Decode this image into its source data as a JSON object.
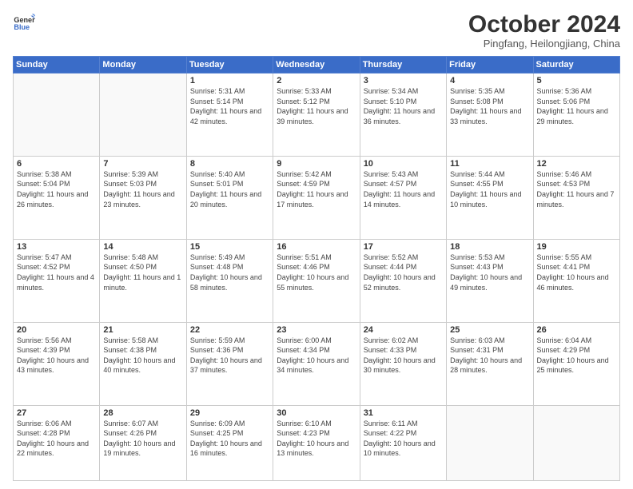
{
  "header": {
    "logo_line1": "General",
    "logo_line2": "Blue",
    "title": "October 2024",
    "subtitle": "Pingfang, Heilongjiang, China"
  },
  "weekdays": [
    "Sunday",
    "Monday",
    "Tuesday",
    "Wednesday",
    "Thursday",
    "Friday",
    "Saturday"
  ],
  "weeks": [
    [
      {
        "day": "",
        "info": ""
      },
      {
        "day": "",
        "info": ""
      },
      {
        "day": "1",
        "info": "Sunrise: 5:31 AM\nSunset: 5:14 PM\nDaylight: 11 hours and 42 minutes."
      },
      {
        "day": "2",
        "info": "Sunrise: 5:33 AM\nSunset: 5:12 PM\nDaylight: 11 hours and 39 minutes."
      },
      {
        "day": "3",
        "info": "Sunrise: 5:34 AM\nSunset: 5:10 PM\nDaylight: 11 hours and 36 minutes."
      },
      {
        "day": "4",
        "info": "Sunrise: 5:35 AM\nSunset: 5:08 PM\nDaylight: 11 hours and 33 minutes."
      },
      {
        "day": "5",
        "info": "Sunrise: 5:36 AM\nSunset: 5:06 PM\nDaylight: 11 hours and 29 minutes."
      }
    ],
    [
      {
        "day": "6",
        "info": "Sunrise: 5:38 AM\nSunset: 5:04 PM\nDaylight: 11 hours and 26 minutes."
      },
      {
        "day": "7",
        "info": "Sunrise: 5:39 AM\nSunset: 5:03 PM\nDaylight: 11 hours and 23 minutes."
      },
      {
        "day": "8",
        "info": "Sunrise: 5:40 AM\nSunset: 5:01 PM\nDaylight: 11 hours and 20 minutes."
      },
      {
        "day": "9",
        "info": "Sunrise: 5:42 AM\nSunset: 4:59 PM\nDaylight: 11 hours and 17 minutes."
      },
      {
        "day": "10",
        "info": "Sunrise: 5:43 AM\nSunset: 4:57 PM\nDaylight: 11 hours and 14 minutes."
      },
      {
        "day": "11",
        "info": "Sunrise: 5:44 AM\nSunset: 4:55 PM\nDaylight: 11 hours and 10 minutes."
      },
      {
        "day": "12",
        "info": "Sunrise: 5:46 AM\nSunset: 4:53 PM\nDaylight: 11 hours and 7 minutes."
      }
    ],
    [
      {
        "day": "13",
        "info": "Sunrise: 5:47 AM\nSunset: 4:52 PM\nDaylight: 11 hours and 4 minutes."
      },
      {
        "day": "14",
        "info": "Sunrise: 5:48 AM\nSunset: 4:50 PM\nDaylight: 11 hours and 1 minute."
      },
      {
        "day": "15",
        "info": "Sunrise: 5:49 AM\nSunset: 4:48 PM\nDaylight: 10 hours and 58 minutes."
      },
      {
        "day": "16",
        "info": "Sunrise: 5:51 AM\nSunset: 4:46 PM\nDaylight: 10 hours and 55 minutes."
      },
      {
        "day": "17",
        "info": "Sunrise: 5:52 AM\nSunset: 4:44 PM\nDaylight: 10 hours and 52 minutes."
      },
      {
        "day": "18",
        "info": "Sunrise: 5:53 AM\nSunset: 4:43 PM\nDaylight: 10 hours and 49 minutes."
      },
      {
        "day": "19",
        "info": "Sunrise: 5:55 AM\nSunset: 4:41 PM\nDaylight: 10 hours and 46 minutes."
      }
    ],
    [
      {
        "day": "20",
        "info": "Sunrise: 5:56 AM\nSunset: 4:39 PM\nDaylight: 10 hours and 43 minutes."
      },
      {
        "day": "21",
        "info": "Sunrise: 5:58 AM\nSunset: 4:38 PM\nDaylight: 10 hours and 40 minutes."
      },
      {
        "day": "22",
        "info": "Sunrise: 5:59 AM\nSunset: 4:36 PM\nDaylight: 10 hours and 37 minutes."
      },
      {
        "day": "23",
        "info": "Sunrise: 6:00 AM\nSunset: 4:34 PM\nDaylight: 10 hours and 34 minutes."
      },
      {
        "day": "24",
        "info": "Sunrise: 6:02 AM\nSunset: 4:33 PM\nDaylight: 10 hours and 30 minutes."
      },
      {
        "day": "25",
        "info": "Sunrise: 6:03 AM\nSunset: 4:31 PM\nDaylight: 10 hours and 28 minutes."
      },
      {
        "day": "26",
        "info": "Sunrise: 6:04 AM\nSunset: 4:29 PM\nDaylight: 10 hours and 25 minutes."
      }
    ],
    [
      {
        "day": "27",
        "info": "Sunrise: 6:06 AM\nSunset: 4:28 PM\nDaylight: 10 hours and 22 minutes."
      },
      {
        "day": "28",
        "info": "Sunrise: 6:07 AM\nSunset: 4:26 PM\nDaylight: 10 hours and 19 minutes."
      },
      {
        "day": "29",
        "info": "Sunrise: 6:09 AM\nSunset: 4:25 PM\nDaylight: 10 hours and 16 minutes."
      },
      {
        "day": "30",
        "info": "Sunrise: 6:10 AM\nSunset: 4:23 PM\nDaylight: 10 hours and 13 minutes."
      },
      {
        "day": "31",
        "info": "Sunrise: 6:11 AM\nSunset: 4:22 PM\nDaylight: 10 hours and 10 minutes."
      },
      {
        "day": "",
        "info": ""
      },
      {
        "day": "",
        "info": ""
      }
    ]
  ]
}
